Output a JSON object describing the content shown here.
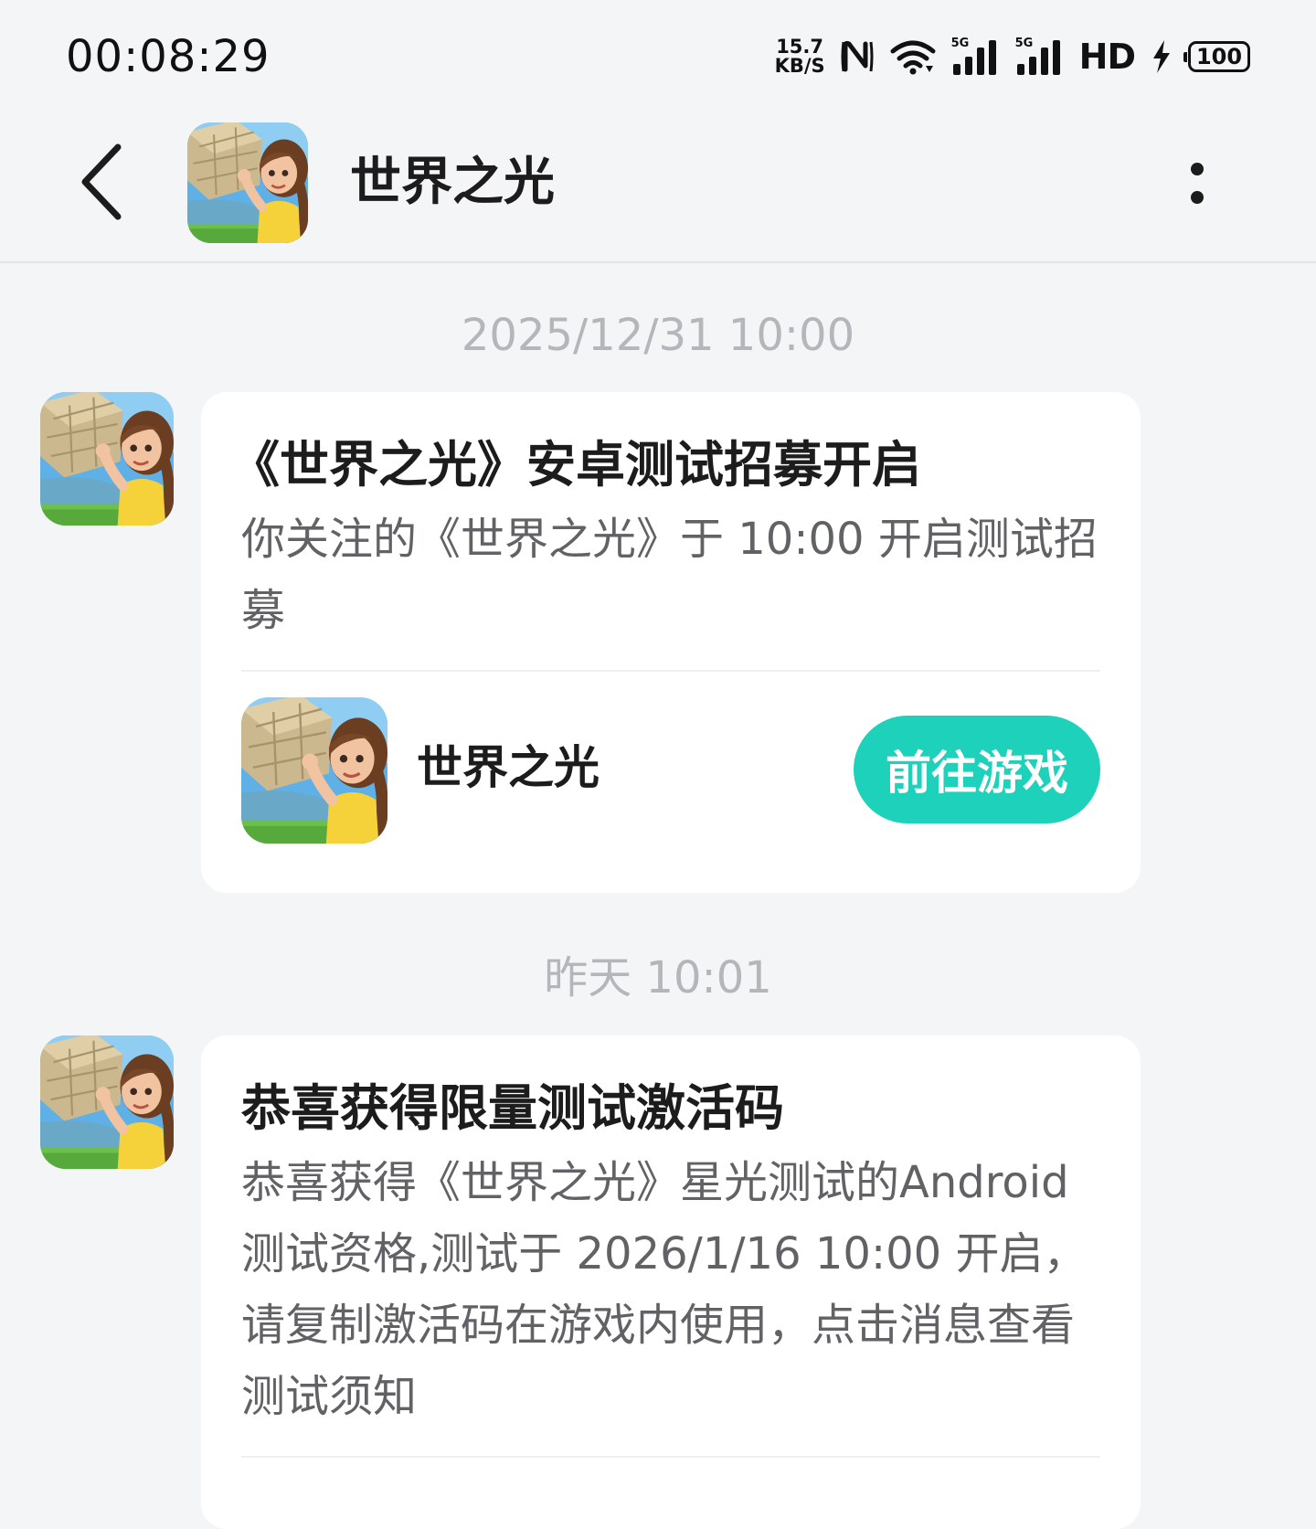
{
  "status_bar": {
    "time": "00:08:29",
    "net_speed_value": "15.7",
    "net_speed_unit": "KB/S",
    "sim1_label": "5G",
    "sim2_label": "5G",
    "hd_label": "HD",
    "battery_level": "100"
  },
  "header": {
    "title": "世界之光",
    "avatar_icon": "game-avatar-icon"
  },
  "messages": [
    {
      "timestamp": "2025/12/31  10:00",
      "title": "《世界之光》安卓测试招募开启",
      "body": "你关注的《世界之光》于 10:00 开启测试招募",
      "game_name": "世界之光",
      "button_label": "前往游戏"
    },
    {
      "timestamp": "昨天  10:01",
      "title": "恭喜获得限量测试激活码",
      "body": "恭喜获得《世界之光》星光测试的Android测试资格,测试于 2026/1/16 10:00 开启，请复制激活码在游戏内使用，点击消息查看测试须知"
    }
  ],
  "colors": {
    "accent": "#1dd1bb",
    "background": "#f4f5f7",
    "timestamp": "#b4b6ba",
    "body_text": "#606266"
  }
}
